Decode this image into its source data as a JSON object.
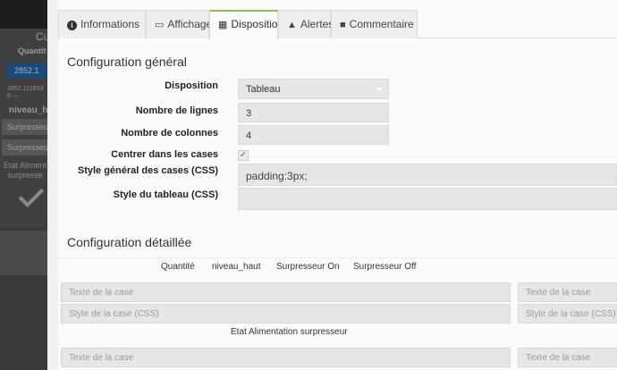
{
  "background": {
    "title": "Cu",
    "quantite": "Quantit",
    "value": "2852,1",
    "small": "2852,112853\n6 —",
    "niveau": "niveau_hc",
    "btn1": "Surpresseu",
    "btn2": "Surpresseu",
    "etat": "Etat Aliment\nsurpresse"
  },
  "tabs": [
    {
      "icon": "i",
      "label": "Informations"
    },
    {
      "icon": "▭",
      "label": "Affichage"
    },
    {
      "icon": "▦",
      "label": "Disposition"
    },
    {
      "icon": "▲",
      "label": "Alertes"
    },
    {
      "icon": "■",
      "label": "Commentaire"
    }
  ],
  "general": {
    "title": "Configuration général",
    "disposition_label": "Disposition",
    "disposition_value": "Tableau",
    "rows_label": "Nombre de lignes",
    "rows_value": "3",
    "cols_label": "Nombre de colonnes",
    "cols_value": "4",
    "center_label": "Centrer dans les cases",
    "center_checked": "✓",
    "cell_style_label": "Style général des cases (CSS)",
    "cell_style_value": "padding:3px;",
    "table_style_label": "Style du tableau (CSS)",
    "table_style_value": ""
  },
  "detailed": {
    "title": "Configuration détaillée",
    "columns": [
      "Quantité",
      "niveau_haut",
      "Surpresseur On",
      "Surpresseur Off"
    ],
    "cell_text_placeholder": "Texte de la case",
    "cell_style_placeholder": "Style de la case (CSS)",
    "row_label": "Etat Alimentation surpresseur"
  },
  "colors": {
    "accent": "#8bc34a",
    "field_bg": "#e6e6e6"
  }
}
